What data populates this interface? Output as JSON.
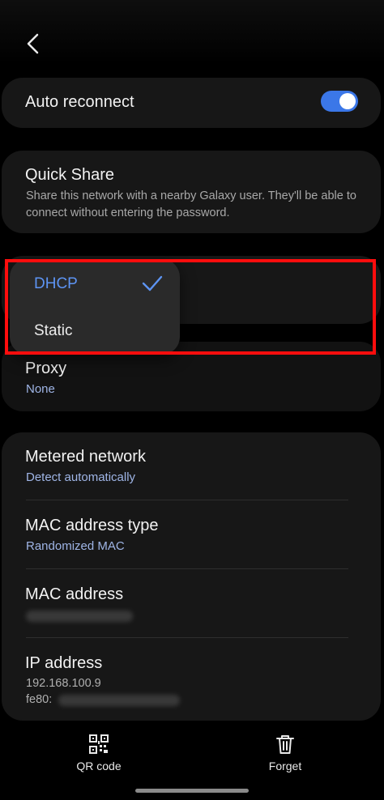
{
  "auto_reconnect": {
    "label": "Auto reconnect",
    "enabled": true
  },
  "quick_share": {
    "title": "Quick Share",
    "description": "Share this network with a nearby Galaxy user. They'll be able to connect without entering the password."
  },
  "ip_settings_menu": {
    "options": [
      "DHCP",
      "Static"
    ],
    "selected": "DHCP"
  },
  "proxy": {
    "title": "Proxy",
    "value": "None"
  },
  "details": {
    "metered": {
      "title": "Metered network",
      "value": "Detect automatically"
    },
    "mac_type": {
      "title": "MAC address type",
      "value": "Randomized MAC"
    },
    "mac_address": {
      "title": "MAC address"
    },
    "ip_address": {
      "title": "IP address",
      "ipv4": "192.168.100.9",
      "ipv6_prefix": "fe80:"
    }
  },
  "bottom_bar": {
    "qr_label": "QR code",
    "forget_label": "Forget"
  },
  "colors": {
    "accent": "#3b77e8",
    "selected_option": "#5d94f3",
    "link_text": "#9fb5e6",
    "highlight": "#ff0d0d",
    "card_bg": "#171717"
  }
}
